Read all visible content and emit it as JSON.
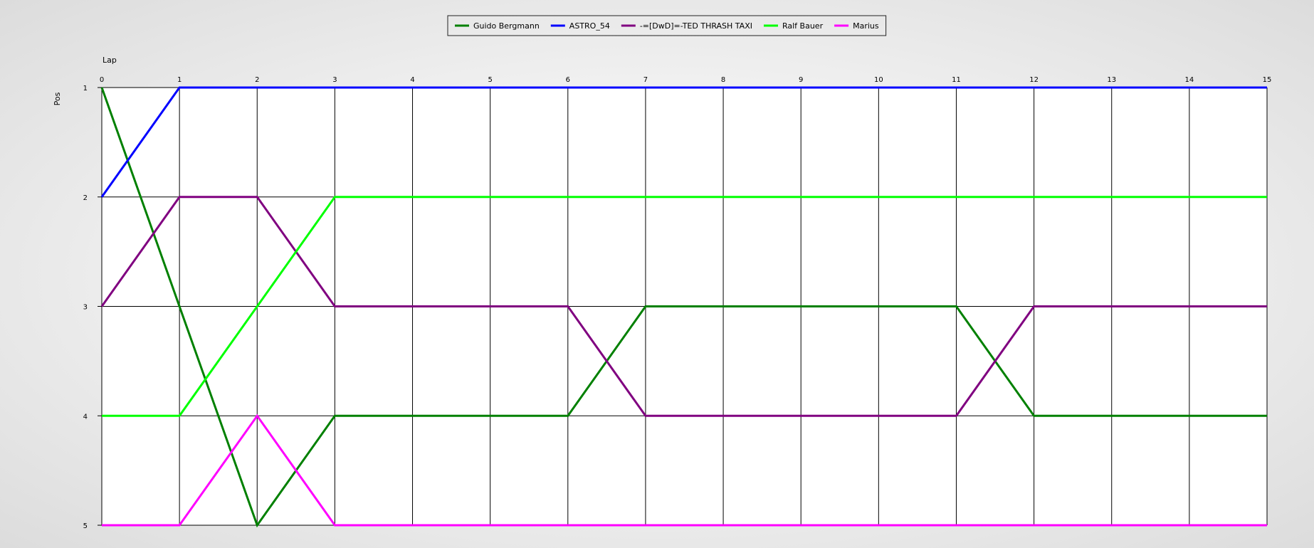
{
  "chart_data": {
    "type": "line",
    "xlabel": "Lap",
    "ylabel": "Pos",
    "x": [
      0,
      1,
      2,
      3,
      4,
      5,
      6,
      7,
      8,
      9,
      10,
      11,
      12,
      13,
      14,
      15
    ],
    "xlim": [
      0,
      15
    ],
    "ylim": [
      1,
      5
    ],
    "y_inverted": true,
    "y_ticks": [
      1,
      2,
      3,
      4,
      5
    ],
    "grid": true,
    "legend_position": "top-center",
    "series": [
      {
        "name": "Guido Bergmann",
        "color": "#008000",
        "values": [
          1,
          3,
          5,
          4,
          4,
          4,
          4,
          3,
          3,
          3,
          3,
          3,
          4,
          4,
          4,
          4
        ]
      },
      {
        "name": "ASTRO_54",
        "color": "#0000ff",
        "values": [
          2,
          1,
          1,
          1,
          1,
          1,
          1,
          1,
          1,
          1,
          1,
          1,
          1,
          1,
          1,
          1
        ]
      },
      {
        "name": "-=[DwD]=-TED THRASH TAXI",
        "color": "#800080",
        "values": [
          3,
          2,
          2,
          3,
          3,
          3,
          3,
          4,
          4,
          4,
          4,
          4,
          3,
          3,
          3,
          3
        ]
      },
      {
        "name": "Ralf Bauer",
        "color": "#00ff00",
        "values": [
          4,
          4,
          3,
          2,
          2,
          2,
          2,
          2,
          2,
          2,
          2,
          2,
          2,
          2,
          2,
          2
        ]
      },
      {
        "name": "Marius",
        "color": "#ff00ff",
        "values": [
          5,
          5,
          4,
          5,
          5,
          5,
          5,
          5,
          5,
          5,
          5,
          5,
          5,
          5,
          5,
          5
        ]
      }
    ]
  }
}
